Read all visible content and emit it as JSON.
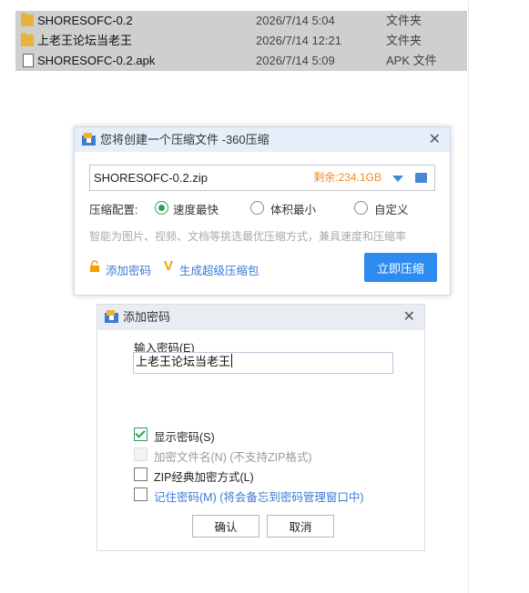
{
  "files": [
    {
      "name": "SHORESOFC-0.2",
      "date": "2026/7/14 5:04",
      "type": "文件夹",
      "icon": "folder-icon"
    },
    {
      "name": "上老王论坛当老王",
      "date": "2026/7/14 12:21",
      "type": "文件夹",
      "icon": "folder-icon"
    },
    {
      "name": "SHORESOFC-0.2.apk",
      "date": "2026/7/14 5:09",
      "type": "APK 文件",
      "icon": "file-icon"
    }
  ],
  "compress_dialog": {
    "title": "您将创建一个压缩文件 -360压缩",
    "path_value": "SHORESOFC-0.2.zip",
    "free_space": "剩余:234.1GB",
    "config_label": "压缩配置:",
    "options": [
      "速度最快",
      "体积最小",
      "自定义"
    ],
    "selected_option": "速度最快",
    "hint": "智能为图片、视频、文档等挑选最优压缩方式，兼具速度和压缩率",
    "add_password_label": "添加密码",
    "super_package_label": "生成超级压缩包",
    "compress_button": "立即压缩"
  },
  "password_dialog": {
    "title": "添加密码",
    "input_label": "输入密码(E)",
    "password_value": "上老王论坛当老王",
    "checkboxes": [
      {
        "label": "显示密码(S)",
        "checked": true,
        "disabled": false
      },
      {
        "label": "加密文件名(N) (不支持ZIP格式)",
        "checked": false,
        "disabled": true
      },
      {
        "label": "ZIP经典加密方式(L)",
        "checked": false,
        "disabled": false
      },
      {
        "label": "记住密码(M) (将会备忘到密码管理窗口中)",
        "checked": false,
        "disabled": false
      }
    ],
    "ok_button": "确认",
    "cancel_button": "取消"
  },
  "colors": {
    "accent": "#2d8cf0",
    "free_space": "#f08a24",
    "link": "#3a7ad6",
    "check_green": "#2f9e5a"
  }
}
